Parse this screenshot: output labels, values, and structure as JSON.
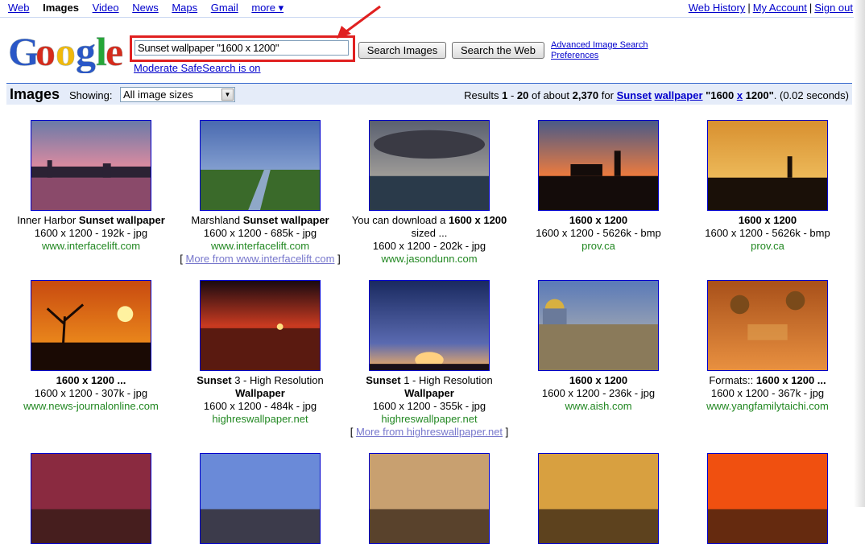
{
  "topnav": {
    "items": [
      "Web",
      "Images",
      "Video",
      "News",
      "Maps",
      "Gmail",
      "more ▾"
    ],
    "current": "Images"
  },
  "toplinks": [
    "Web History",
    "My Account",
    "Sign out"
  ],
  "search": {
    "query": "Sunset wallpaper \"1600 x 1200\"",
    "search_images_label": "Search Images",
    "search_web_label": "Search the Web",
    "advanced_label": "Advanced Image Search",
    "preferences_label": "Preferences",
    "safesearch_label": "Moderate SafeSearch is on"
  },
  "band": {
    "title": "Images",
    "showing_label": "Showing:",
    "size_select": "All image sizes",
    "results_prefix": "Results ",
    "range_start": "1",
    "range_end": "20",
    "about": "2,370",
    "query_words": [
      "Sunset",
      "wallpaper"
    ],
    "query_quoted_a": "\"1600 ",
    "query_x": "x",
    "query_quoted_b": " 1200\"",
    "time": "(0.02 seconds)"
  },
  "results": [
    {
      "pre": "Inner Harbor ",
      "bold": "Sunset wallpaper",
      "post": "",
      "meta": "1600 x 1200 - 192k - jpg",
      "source": "www.interfacelift.com",
      "more": "",
      "theme": "harbor"
    },
    {
      "pre": "Marshland ",
      "bold": "Sunset wallpaper",
      "post": "",
      "meta": "1600 x 1200 - 685k - jpg",
      "source": "www.interfacelift.com",
      "more": "More from www.interfacelift.com",
      "theme": "marsh"
    },
    {
      "pre": "You can download a ",
      "bold": "1600 x 1200",
      "post": " sized ...",
      "meta": "1600 x 1200 - 202k - jpg",
      "source": "www.jasondunn.com",
      "more": "",
      "theme": "clouds"
    },
    {
      "pre": "",
      "bold": "1600 x 1200",
      "post": "",
      "meta": "1600 x 1200 - 5626k - bmp",
      "source": "prov.ca",
      "more": "",
      "theme": "silhouette"
    },
    {
      "pre": "",
      "bold": "1600 x 1200",
      "post": "",
      "meta": "1600 x 1200 - 5626k - bmp",
      "source": "prov.ca",
      "more": "",
      "theme": "rays"
    },
    {
      "pre": "",
      "bold": "1600 x 1200 ...",
      "post": "",
      "meta": "1600 x 1200 - 307k - jpg",
      "source": "www.news-journalonline.com",
      "more": "",
      "theme": "tree"
    },
    {
      "pre": "",
      "bold": "Sunset",
      "post": " 3 - High Resolution ",
      "bold2": "Wallpaper",
      "meta": "1600 x 1200 - 484k - jpg",
      "source": "highreswallpaper.net",
      "more": "",
      "theme": "sea"
    },
    {
      "pre": "",
      "bold": "Sunset",
      "post": " 1 - High Resolution ",
      "bold2": "Wallpaper",
      "meta": "1600 x 1200 - 355k - jpg",
      "source": "highreswallpaper.net",
      "more": "More from highreswallpaper.net",
      "theme": "sky"
    },
    {
      "pre": "",
      "bold": "1600 x 1200",
      "post": "",
      "meta": "1600 x 1200 - 236k - jpg",
      "source": "www.aish.com",
      "more": "",
      "theme": "dome"
    },
    {
      "pre": "Formats:: ",
      "bold": "1600 x 1200 ...",
      "post": "",
      "meta": "1600 x 1200 - 367k - jpg",
      "source": "www.yangfamilytaichi.com",
      "more": "",
      "theme": "poster"
    }
  ],
  "colors": {
    "link": "#0000cc",
    "source_green": "#228822",
    "band_bg": "#e5ecf9",
    "highlight_red": "#e02020"
  }
}
